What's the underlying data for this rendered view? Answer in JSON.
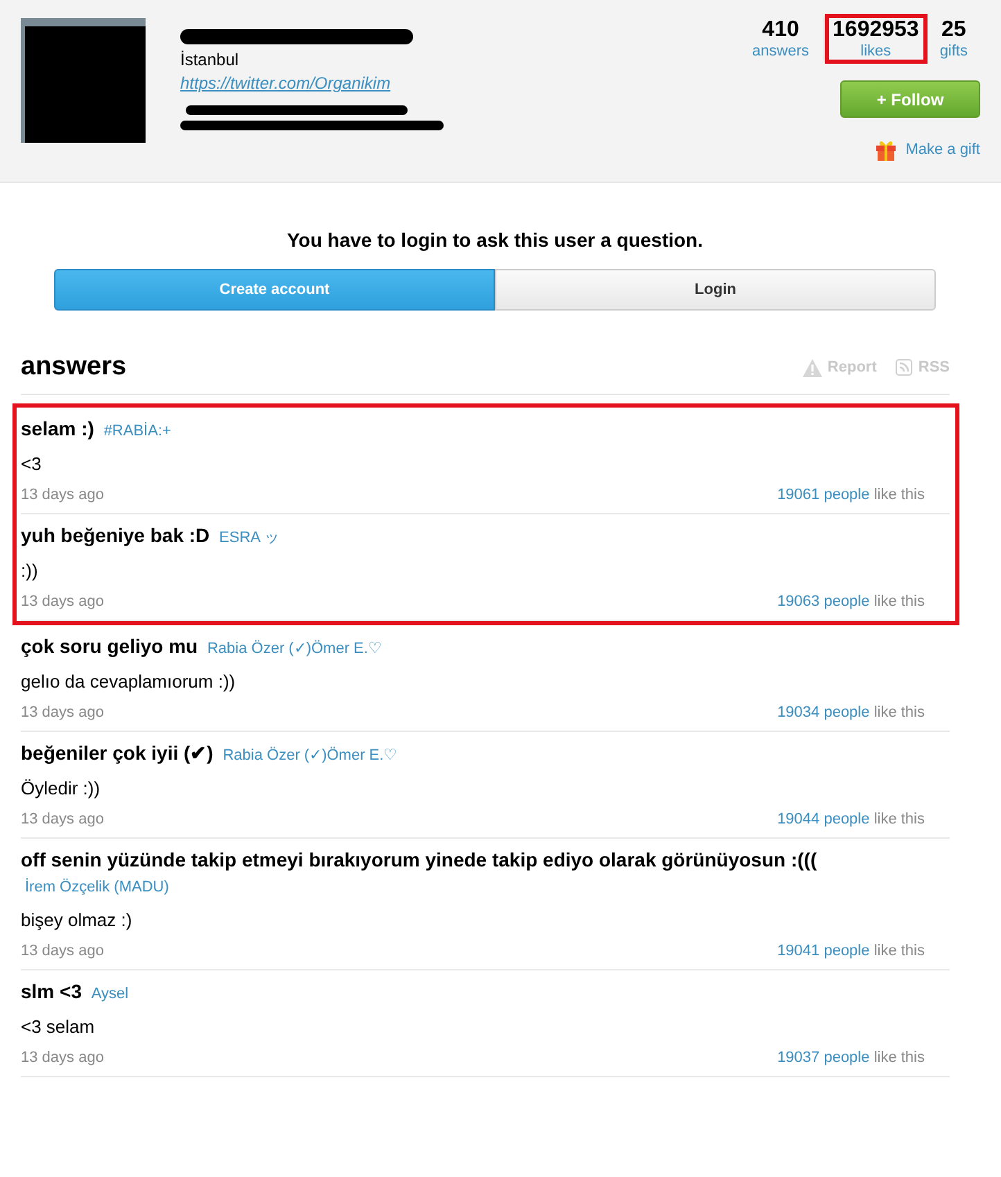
{
  "profile": {
    "city": "İstanbul",
    "links": [
      "https://twitter.com/Organikim"
    ],
    "stats": [
      {
        "value": "410",
        "label": "answers",
        "highlighted": false
      },
      {
        "value": "1692953",
        "label": "likes",
        "highlighted": true
      },
      {
        "value": "25",
        "label": "gifts",
        "highlighted": false
      }
    ],
    "follow_button": "+ Follow",
    "gift_link": "Make a gift"
  },
  "login_prompt": {
    "message": "You have to login to ask this user a question.",
    "buttons": [
      {
        "label": "Create account",
        "kind": "primary"
      },
      {
        "label": "Login",
        "kind": "secondary"
      }
    ]
  },
  "answers_section": {
    "title": "answers",
    "actions": [
      {
        "label": "Report",
        "kind": "report"
      },
      {
        "label": "RSS",
        "kind": "rss"
      }
    ],
    "answers": [
      {
        "question": "selam :)",
        "asker": "#RABİA:+",
        "answer": "<3",
        "time": "13 days ago",
        "likes": "19061 people",
        "likes_suffix": "like this",
        "highlighted": true
      },
      {
        "question": "yuh beğeniye bak :D",
        "asker": "ESRA ッ",
        "answer": ":))",
        "time": "13 days ago",
        "likes": "19063 people",
        "likes_suffix": "like this",
        "highlighted": true
      },
      {
        "question": "çok soru geliyo mu",
        "asker": "Rabia Özer (✓)Ömer E.♡",
        "answer": "gelıo da cevaplamıorum :))",
        "time": "13 days ago",
        "likes": "19034 people",
        "likes_suffix": "like this",
        "highlighted": false
      },
      {
        "question": "beğeniler çok iyii (✔)",
        "asker": "Rabia Özer (✓)Ömer E.♡",
        "answer": "Öyledir :))",
        "time": "13 days ago",
        "likes": "19044 people",
        "likes_suffix": "like this",
        "highlighted": false
      },
      {
        "question": "off senin yüzünde takip etmeyi bırakıyorum yinede takip ediyo olarak görünüyosun :(((",
        "asker": "İrem Özçelik (MADU)",
        "answer": "bişey olmaz :)",
        "time": "13 days ago",
        "likes": "19041 people",
        "likes_suffix": "like this",
        "highlighted": false
      },
      {
        "question": "slm <3",
        "asker": "Aysel",
        "answer": "<3 selam",
        "time": "13 days ago",
        "likes": "19037 people",
        "likes_suffix": "like this",
        "highlighted": false
      }
    ]
  }
}
